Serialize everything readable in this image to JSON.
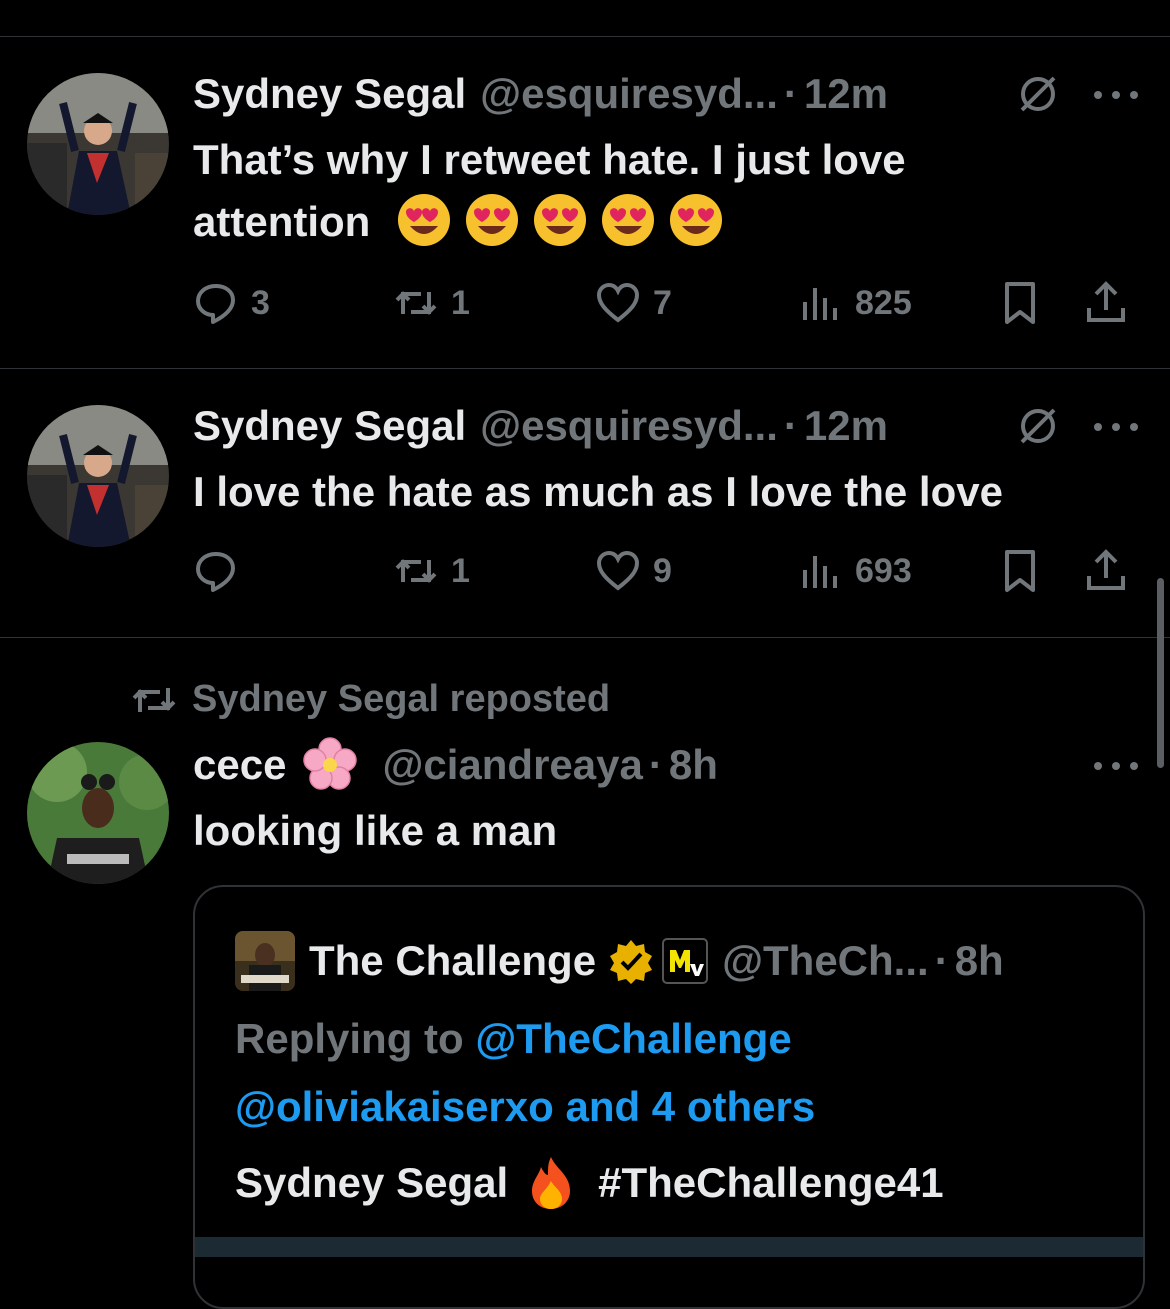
{
  "colors": {
    "background": "#000000",
    "text": "#e7e9ea",
    "muted": "#71767b",
    "link": "#1d9bf0",
    "divider": "#2f3336",
    "verified": "#e8b100"
  },
  "tweets": [
    {
      "author_name": "Sydney Segal",
      "handle": "@esquiresyd...",
      "dot": "·",
      "time": "12m",
      "text_line1": "That’s why I retweet hate. I just love",
      "text_line2": "attention",
      "emoji_count_icon": "heart-eyes-emoji",
      "replies": "3",
      "reposts": "1",
      "likes": "7",
      "views": "825"
    },
    {
      "author_name": "Sydney Segal",
      "handle": "@esquiresyd...",
      "dot": "·",
      "time": "12m",
      "text_line1": "I love the hate as much as I love the love",
      "replies": "",
      "reposts": "1",
      "likes": "9",
      "views": "693"
    }
  ],
  "repost": {
    "label": "Sydney Segal reposted",
    "author_name": "cece",
    "name_emoji": "cherry-blossom-emoji",
    "handle": "@ciandreaya",
    "dot": "·",
    "time": "8h",
    "text": "looking like a man",
    "quote": {
      "author_name": "The Challenge",
      "badge": "verified-gold-icon",
      "affiliate": "mtv-logo",
      "handle": "@TheCh...",
      "dot": "·",
      "time": "8h",
      "replying_prefix": "Replying to",
      "replying_handle": "@TheChallenge",
      "replying_line2": "@oliviakaiserxo and 4 others",
      "text_name": "Sydney Segal",
      "fire_emoji": "fire-emoji",
      "hashtag": "#TheChallenge41"
    }
  }
}
